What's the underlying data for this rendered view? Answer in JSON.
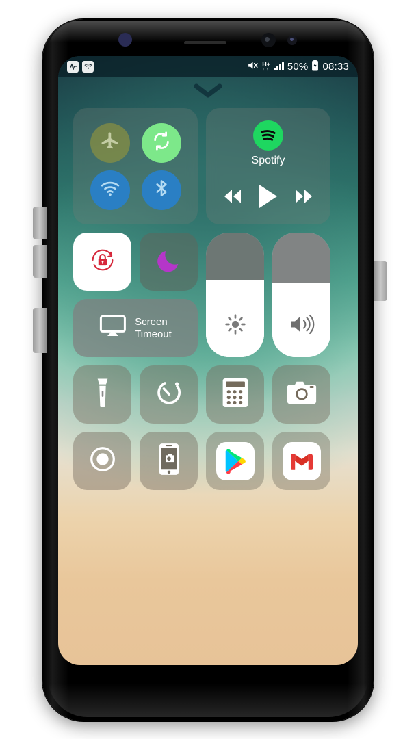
{
  "device": {
    "name": "Samsung Galaxy S8",
    "sensors": [
      "iris-scanner",
      "earpiece-speaker",
      "front-camera",
      "notification-led"
    ],
    "buttons": [
      "volume-up",
      "volume-down",
      "bixby",
      "power"
    ]
  },
  "status_bar": {
    "left_icons": [
      "activity-notification-icon",
      "wifi-notification-icon"
    ],
    "mute_icon": "mute-icon",
    "network_type": "H+",
    "network_sub": "↓↑",
    "signal_bars": 4,
    "battery_percent": "50%",
    "battery_icon": "battery-icon",
    "clock": "08:33"
  },
  "control_center": {
    "handle_icon": "chevron-down-icon",
    "connectivity": {
      "airplane": {
        "label": "Airplane Mode",
        "icon": "airplane-icon",
        "active": false,
        "color": "#96963c"
      },
      "sync": {
        "label": "Sync",
        "icon": "sync-icon",
        "active": true,
        "color": "#7de88a"
      },
      "wifi": {
        "label": "Wi-Fi",
        "icon": "wifi-icon",
        "active": true,
        "color": "#2a7fc4"
      },
      "bluetooth": {
        "label": "Bluetooth",
        "icon": "bluetooth-icon",
        "active": true,
        "color": "#2a7fc4"
      }
    },
    "music": {
      "app_name": "Spotify",
      "app_icon": "spotify-icon",
      "brand_color": "#1ed760",
      "controls": [
        "previous-track",
        "play",
        "next-track"
      ]
    },
    "toggles": {
      "rotation_lock": {
        "label": "Rotation Lock",
        "icon": "rotation-lock-icon",
        "active": true,
        "color": "#d6283b"
      },
      "do_not_disturb": {
        "label": "Do Not Disturb",
        "icon": "moon-icon",
        "active": false,
        "color": "#b536c9"
      },
      "screen_timeout": {
        "label_line1": "Screen",
        "label_line2": "Timeout",
        "icon": "screen-mirror-icon"
      }
    },
    "sliders": {
      "brightness": {
        "label": "Brightness",
        "icon": "brightness-icon",
        "value": 62
      },
      "volume": {
        "label": "Volume",
        "icon": "volume-icon",
        "value": 60
      }
    },
    "shortcuts_row1": [
      {
        "label": "Flashlight",
        "icon": "flashlight-icon"
      },
      {
        "label": "Timer",
        "icon": "timer-icon"
      },
      {
        "label": "Calculator",
        "icon": "calculator-icon"
      },
      {
        "label": "Camera",
        "icon": "camera-icon"
      }
    ],
    "shortcuts_row2": [
      {
        "label": "Screen Record",
        "icon": "record-icon"
      },
      {
        "label": "Screenshot",
        "icon": "screenshot-icon"
      },
      {
        "label": "Play Store",
        "icon": "play-store-icon"
      },
      {
        "label": "Gmail",
        "icon": "gmail-icon"
      }
    ]
  }
}
